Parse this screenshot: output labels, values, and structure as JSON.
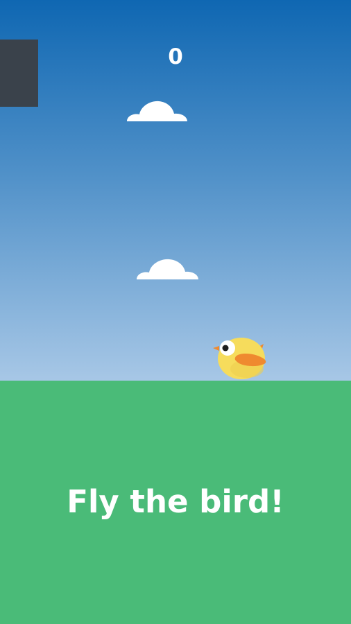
{
  "hud": {
    "score": "0"
  },
  "prompt": {
    "tagline": "Fly the bird!"
  },
  "scene": {
    "sky_top_color": "#0f67b2",
    "sky_bottom_color": "#a7c7e6",
    "ground_color": "#4abb78",
    "side_panel_color": "#3a424b",
    "bird_body_color": "#f6dc5c",
    "bird_wing_color": "#ef8a2f",
    "icons": [
      "cloud-icon",
      "bird-icon"
    ]
  }
}
